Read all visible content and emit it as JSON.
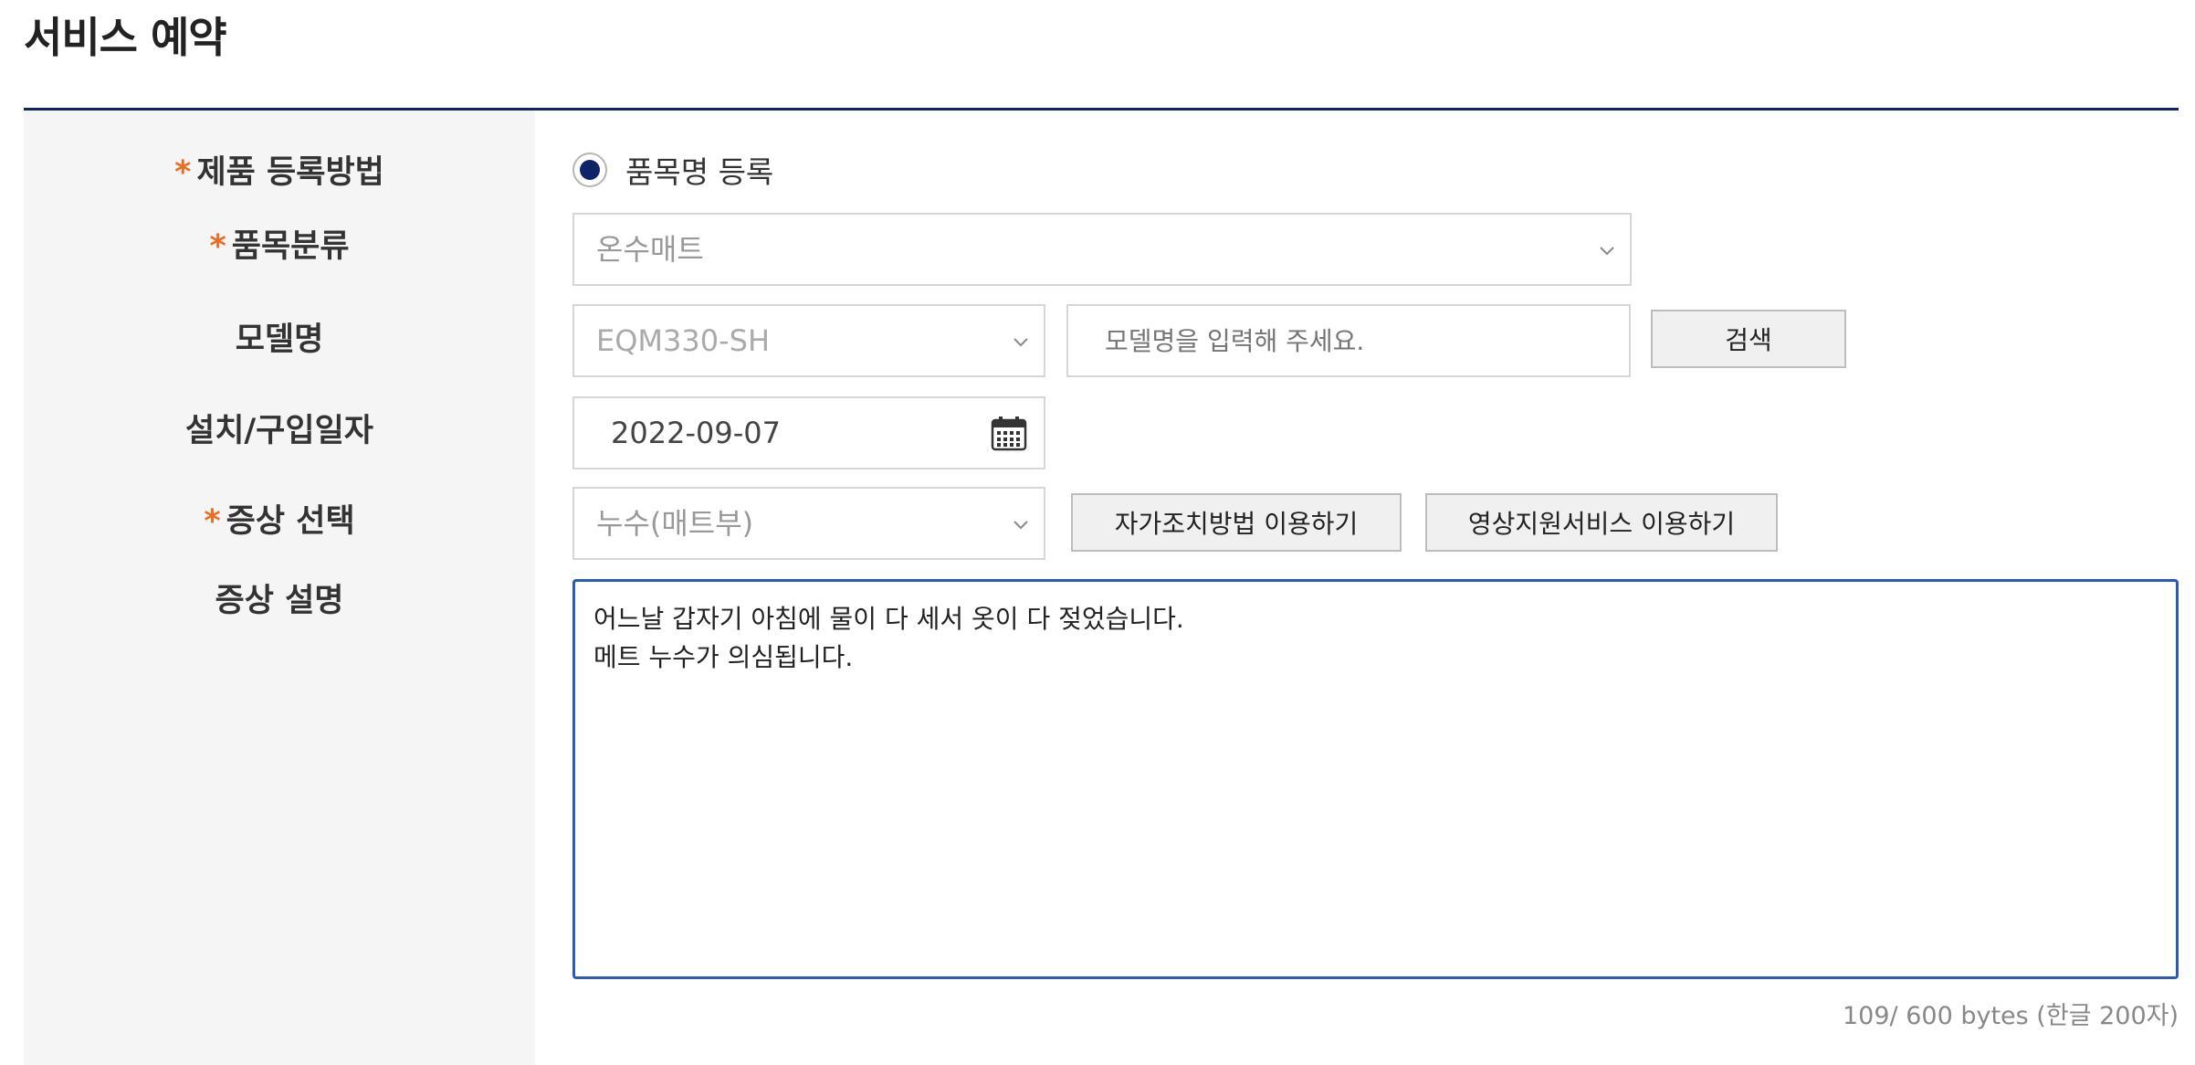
{
  "page": {
    "title": "서비스 예약"
  },
  "labels": {
    "required_mark": "*",
    "registration_method": "제품 등록방법",
    "category": "품목분류",
    "model": "모델명",
    "install_date": "설치/구입일자",
    "symptom": "증상 선택",
    "symptom_desc": "증상 설명"
  },
  "registration": {
    "option_label": "품목명 등록",
    "selected": true
  },
  "category_select": {
    "value": "온수매트"
  },
  "model_select": {
    "value": "EQM330-SH"
  },
  "model_search": {
    "placeholder": "모델명을 입력해 주세요.",
    "button": "검색"
  },
  "install_date": {
    "value": "2022-09-07"
  },
  "symptom_select": {
    "value": "누수(매트부)"
  },
  "buttons": {
    "self_help": "자가조치방법 이용하기",
    "video_support": "영상지원서비스 이용하기"
  },
  "description": {
    "value": "어느날 갑자기 아침에 물이 다 세서 옷이 다 젖었습니다.\n메트 누수가 의심됩니다.",
    "byte_count": "109/ 600 bytes (한글 200자)"
  },
  "colors": {
    "accent": "#0f2468",
    "required": "#ea6d24",
    "focus": "#2a5ab5"
  },
  "icons": {
    "select_arrow": "chevron-down-icon",
    "date_picker": "calendar-icon"
  }
}
